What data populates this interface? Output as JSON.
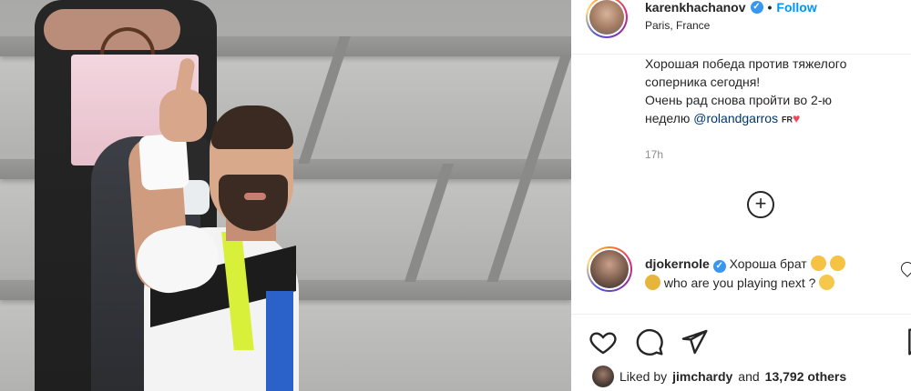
{
  "post": {
    "username": "karenkhachanov",
    "follow_label": "Follow",
    "separator": "•",
    "location": "Paris, France",
    "caption_line1": "Хорошая победа против тяжелого",
    "caption_line2": "соперника сегодня!",
    "caption_line3": "Очень рад снова пройти во 2-ю",
    "caption_line4_prefix": "неделю ",
    "caption_mention": "@rolandgarros",
    "caption_flag": "FR",
    "time": "17h"
  },
  "comment": {
    "username": "djokernole",
    "text_line1": "Хороша брат",
    "text_line2": "who are you playing next ?"
  },
  "likes": {
    "prefix": "Liked by",
    "user": "jimchardy",
    "connector": "and",
    "count": "13,792 others"
  },
  "icons": {
    "verified": "verified-badge-icon",
    "add": "plus-circle-icon",
    "like": "heart-icon",
    "comment": "comment-bubble-icon",
    "share": "paper-plane-icon",
    "save": "bookmark-icon"
  },
  "colors": {
    "follow": "#0095f6",
    "verified": "#3897f0",
    "mention": "#00376b",
    "heart": "#ed4956"
  }
}
